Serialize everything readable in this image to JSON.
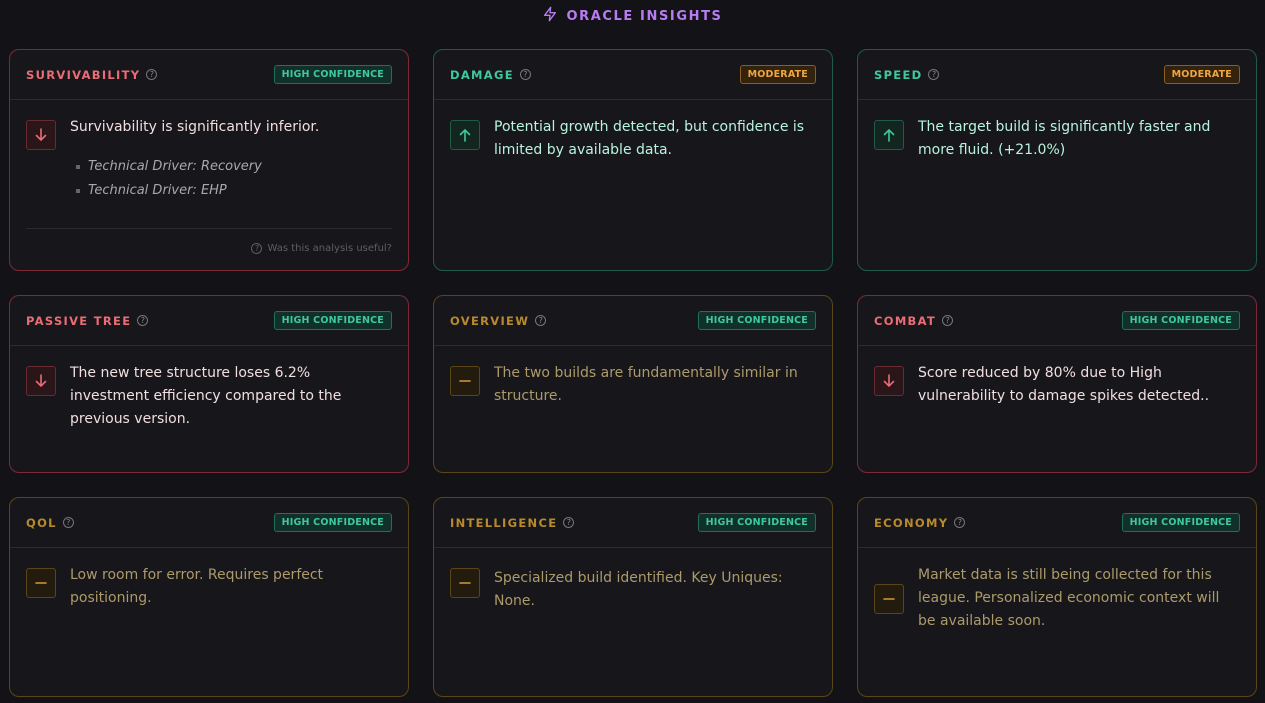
{
  "header": {
    "title": "ORACLE INSIGHTS",
    "icon": "lightning-icon"
  },
  "cards": [
    {
      "title": "SURVIVABILITY",
      "badge": "HIGH CONFIDENCE",
      "tone": "red",
      "direction": "down",
      "text": "Survivability is significantly inferior.",
      "drivers": [
        "Technical Driver: Recovery",
        "Technical Driver: EHP"
      ],
      "feedback": "Was this analysis useful?"
    },
    {
      "title": "DAMAGE",
      "badge": "MODERATE",
      "tone": "green",
      "direction": "up",
      "text": "Potential growth detected, but confidence is limited by available data."
    },
    {
      "title": "SPEED",
      "badge": "MODERATE",
      "tone": "green",
      "direction": "up",
      "text": "The target build is significantly faster and more fluid. (+21.0%)"
    },
    {
      "title": "PASSIVE TREE",
      "badge": "HIGH CONFIDENCE",
      "tone": "red",
      "direction": "down",
      "text": "The new tree structure loses 6.2% investment efficiency compared to the previous version."
    },
    {
      "title": "OVERVIEW",
      "badge": "HIGH CONFIDENCE",
      "tone": "amber",
      "direction": "neutral",
      "text": "The two builds are fundamentally similar in structure."
    },
    {
      "title": "COMBAT",
      "badge": "HIGH CONFIDENCE",
      "tone": "red",
      "direction": "down",
      "text": "Score reduced by 80% due to High vulnerability to damage spikes detected.."
    },
    {
      "title": "QOL",
      "badge": "HIGH CONFIDENCE",
      "tone": "amber",
      "direction": "neutral",
      "text": "Low room for error. Requires perfect positioning."
    },
    {
      "title": "INTELLIGENCE",
      "badge": "HIGH CONFIDENCE",
      "tone": "amber",
      "direction": "neutral",
      "text": "Specialized build identified. Key Uniques: None."
    },
    {
      "title": "ECONOMY",
      "badge": "HIGH CONFIDENCE",
      "tone": "amber",
      "direction": "neutral",
      "text": "Market data is still being collected for this league. Personalized economic context will be available soon."
    }
  ]
}
